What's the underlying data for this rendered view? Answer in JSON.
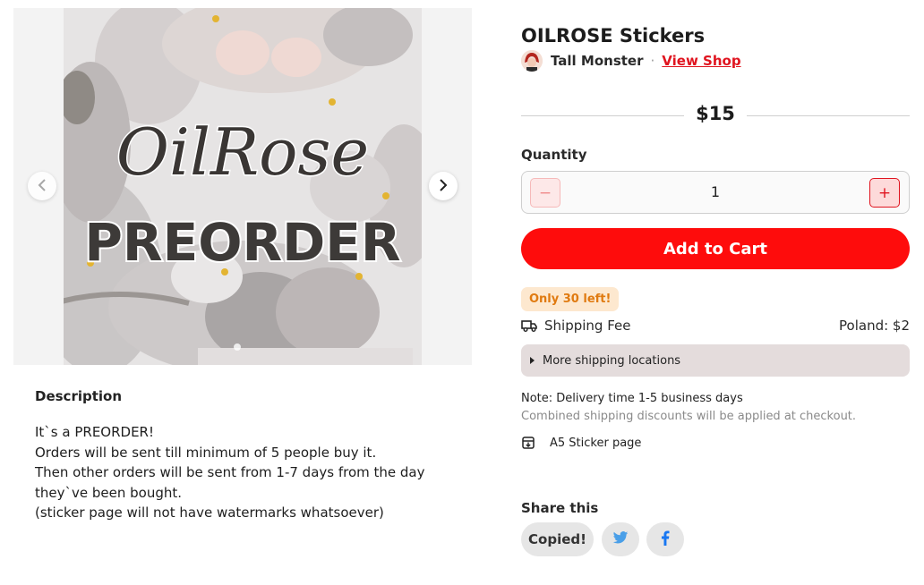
{
  "product": {
    "title": "OILROSE Stickers",
    "price": "$15",
    "image_text": {
      "logo": "OilRose",
      "banner": "PREORDER"
    }
  },
  "shop": {
    "name": "Tall Monster",
    "separator": "·",
    "view_shop_label": "View Shop"
  },
  "quantity": {
    "label": "Quantity",
    "value": "1",
    "minus_glyph": "−",
    "plus_glyph": "+"
  },
  "cart": {
    "add_label": "Add to Cart"
  },
  "stock": {
    "badge": "Only 30 left!"
  },
  "shipping": {
    "label": "Shipping Fee",
    "value": "Poland: $2",
    "more_label": "More shipping locations",
    "note": "Note: Delivery time 1-5 business days",
    "discount_note": "Combined shipping discounts will be applied at checkout."
  },
  "file": {
    "label": "A5 Sticker page"
  },
  "description": {
    "heading": "Description",
    "lines": [
      "It`s a PREORDER!",
      "Orders will be sent till minimum of 5 people buy it.",
      "Then other orders will be sent from 1-7 days from the day",
      "they`ve been bought.",
      "(sticker page will not have watermarks whatsoever)"
    ]
  },
  "share": {
    "heading": "Share this",
    "copied_label": "Copied!",
    "buttons": [
      {
        "name": "twitter",
        "icon": "twitter-bird-icon",
        "color": "#4a9fe8"
      },
      {
        "name": "facebook",
        "icon": "facebook-f-icon",
        "color": "#1877f2"
      }
    ]
  },
  "colors": {
    "accent": "#fe0c0c",
    "link": "#e0141f",
    "stock_badge_bg": "#fde8cf",
    "stock_badge_text": "#e07a10"
  },
  "gallery": {
    "prev_icon": "chevron-left-icon",
    "next_icon": "chevron-right-icon"
  }
}
